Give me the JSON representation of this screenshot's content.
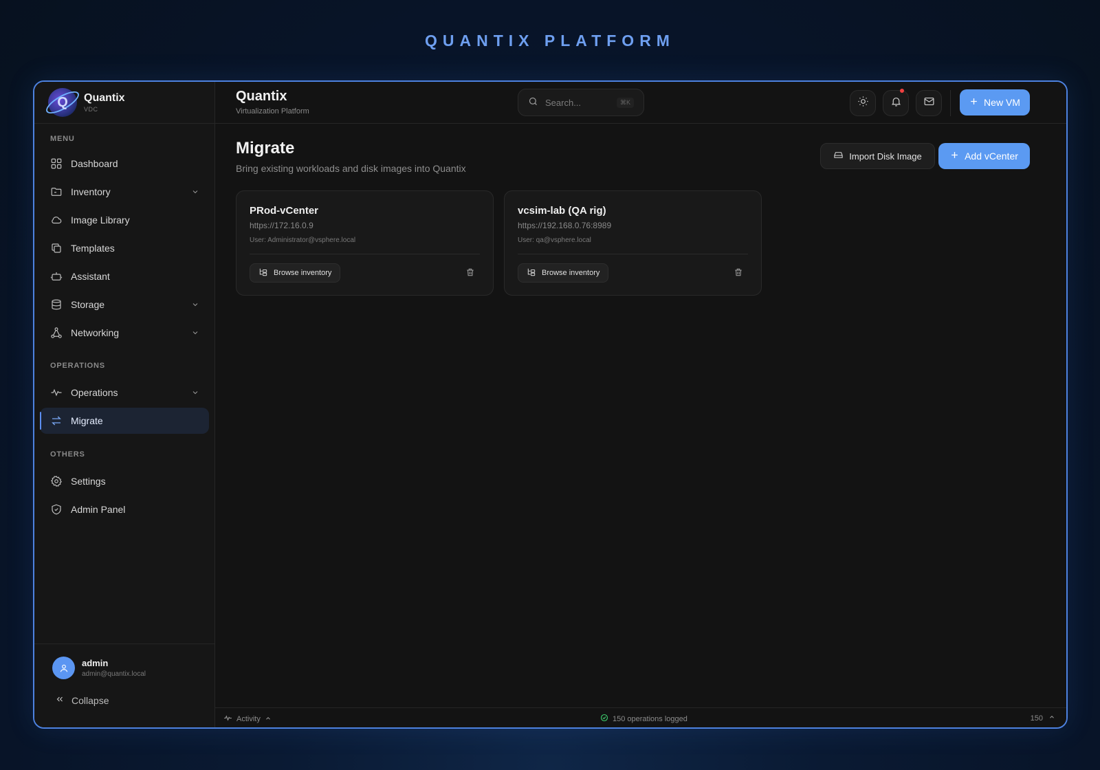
{
  "brand_banner": "QUANTIX PLATFORM",
  "sidebar": {
    "app_name": "Quantix",
    "app_sub": "VDC",
    "sections": {
      "menu": "MENU",
      "operations": "OPERATIONS",
      "others": "OTHERS"
    },
    "items": [
      {
        "label": "Dashboard",
        "icon": "grid-icon"
      },
      {
        "label": "Inventory",
        "icon": "folder-icon",
        "expandable": true
      },
      {
        "label": "Image Library",
        "icon": "cloud-icon"
      },
      {
        "label": "Templates",
        "icon": "copy-icon"
      },
      {
        "label": "Assistant",
        "icon": "bot-icon"
      },
      {
        "label": "Storage",
        "icon": "database-icon",
        "expandable": true
      },
      {
        "label": "Networking",
        "icon": "network-icon",
        "expandable": true
      },
      {
        "label": "Operations",
        "icon": "activity-icon",
        "expandable": true
      },
      {
        "label": "Migrate",
        "icon": "arrows-exchange-icon",
        "active": true
      },
      {
        "label": "Settings",
        "icon": "gear-icon"
      },
      {
        "label": "Admin Panel",
        "icon": "shield-icon"
      }
    ],
    "user": {
      "name": "admin",
      "email": "admin@quantix.local"
    },
    "collapse_label": "Collapse"
  },
  "topbar": {
    "title": "Quantix",
    "subtitle": "Virtualization Platform",
    "search_placeholder": "Search...",
    "search_shortcut": "⌘K",
    "new_vm_label": "New VM"
  },
  "page": {
    "title": "Migrate",
    "subtitle": "Bring existing workloads and disk images into Quantix",
    "import_label": "Import Disk Image",
    "add_label": "Add vCenter"
  },
  "vcenters": [
    {
      "name": "PRod-vCenter",
      "url": "https://172.16.0.9",
      "user": "User: Administrator@vsphere.local",
      "browse_label": "Browse inventory"
    },
    {
      "name": "vcsim-lab (QA rig)",
      "url": "https://192.168.0.76:8989",
      "user": "User: qa@vsphere.local",
      "browse_label": "Browse inventory"
    }
  ],
  "statusbar": {
    "activity_label": "Activity",
    "ops_logged": "150 operations logged",
    "count": "150"
  },
  "colors": {
    "accent": "#5b9af2",
    "banner": "#6e9ff0",
    "status_ok": "#3ecf6e",
    "notification": "#f04040"
  }
}
